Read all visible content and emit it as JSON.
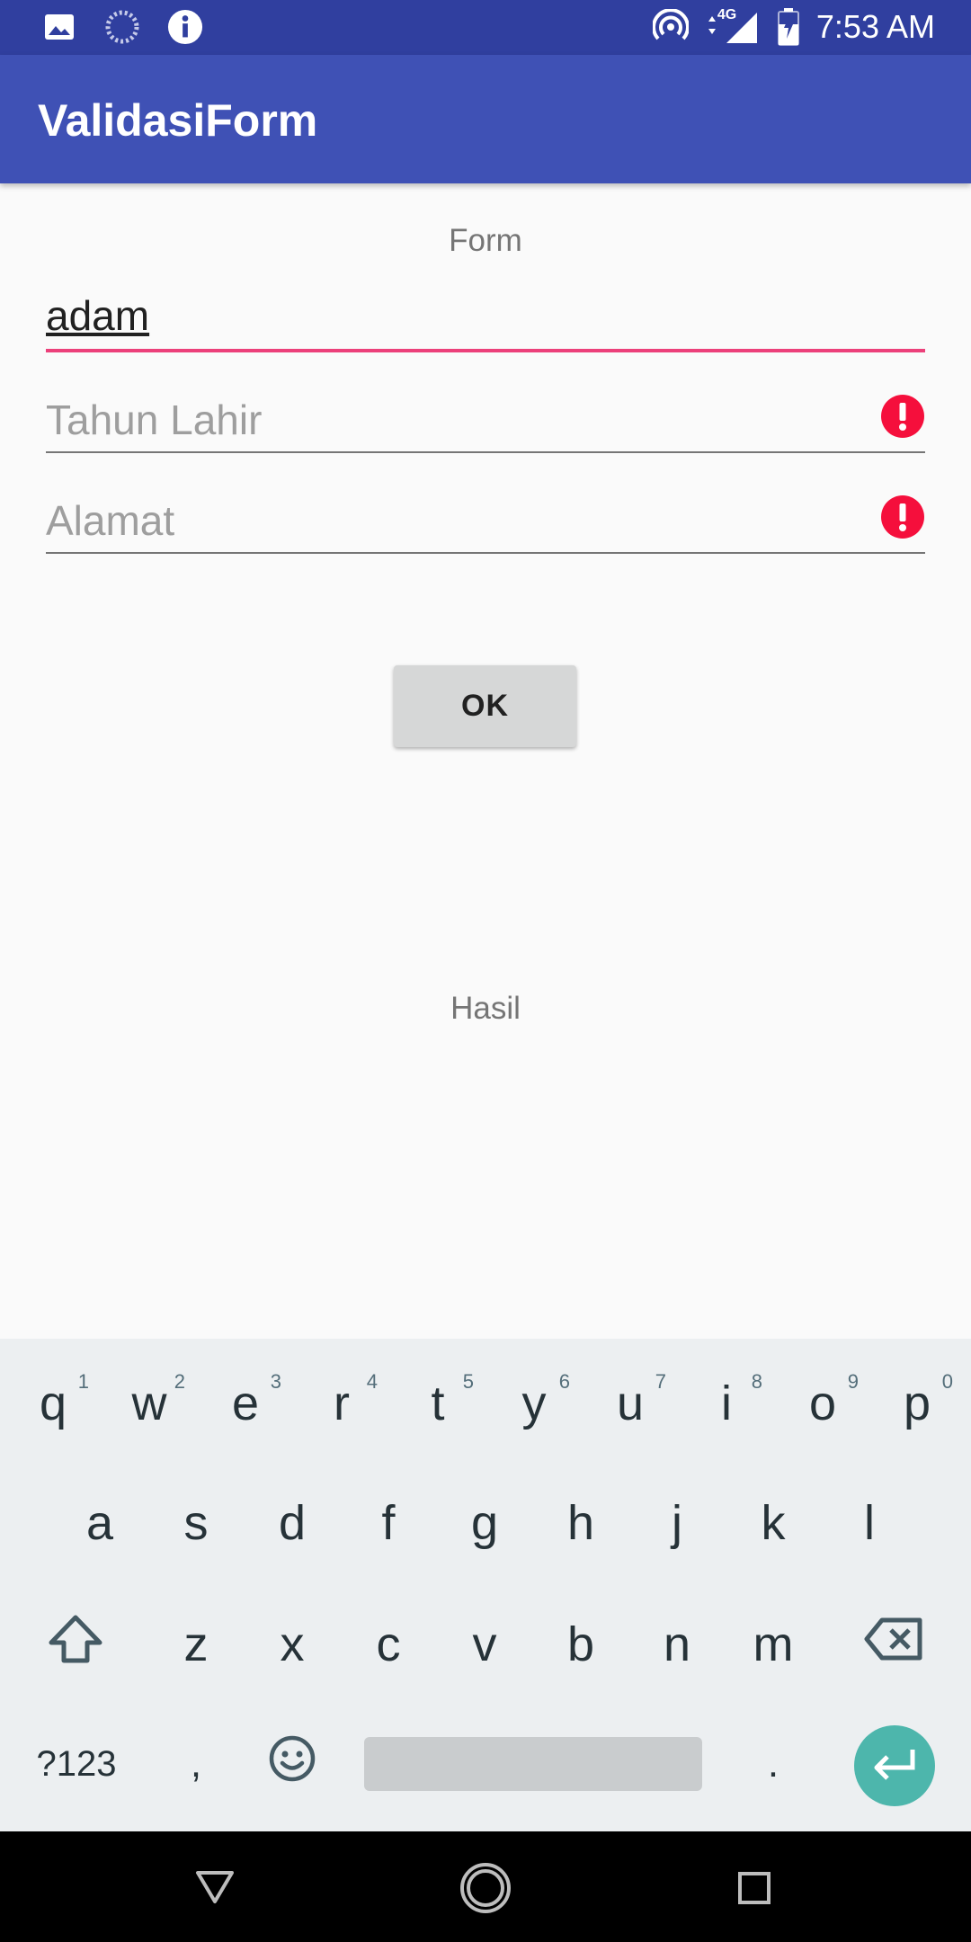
{
  "status_bar": {
    "time": "7:53 AM",
    "network": "4G",
    "left_icons": [
      "image-icon",
      "loading-icon",
      "info-icon"
    ],
    "right_icons": [
      "hotspot-icon",
      "signal-icon",
      "battery-icon"
    ]
  },
  "app_bar": {
    "title": "ValidasiForm"
  },
  "form": {
    "label": "Form",
    "name_value": "adam",
    "tahun_placeholder": "Tahun Lahir",
    "alamat_placeholder": "Alamat",
    "ok_label": "OK",
    "result_label": "Hasil"
  },
  "keyboard": {
    "row1": [
      {
        "k": "q",
        "h": "1"
      },
      {
        "k": "w",
        "h": "2"
      },
      {
        "k": "e",
        "h": "3"
      },
      {
        "k": "r",
        "h": "4"
      },
      {
        "k": "t",
        "h": "5"
      },
      {
        "k": "y",
        "h": "6"
      },
      {
        "k": "u",
        "h": "7"
      },
      {
        "k": "i",
        "h": "8"
      },
      {
        "k": "o",
        "h": "9"
      },
      {
        "k": "p",
        "h": "0"
      }
    ],
    "row2": [
      "a",
      "s",
      "d",
      "f",
      "g",
      "h",
      "j",
      "k",
      "l"
    ],
    "row3": [
      "z",
      "x",
      "c",
      "v",
      "b",
      "n",
      "m"
    ],
    "symbols_label": "?123",
    "comma": ",",
    "period": "."
  },
  "colors": {
    "status_bar": "#303f9f",
    "app_bar": "#3f51b5",
    "accent": "#ec407a",
    "error": "#f50f3c",
    "enter_key": "#4db6ac"
  }
}
